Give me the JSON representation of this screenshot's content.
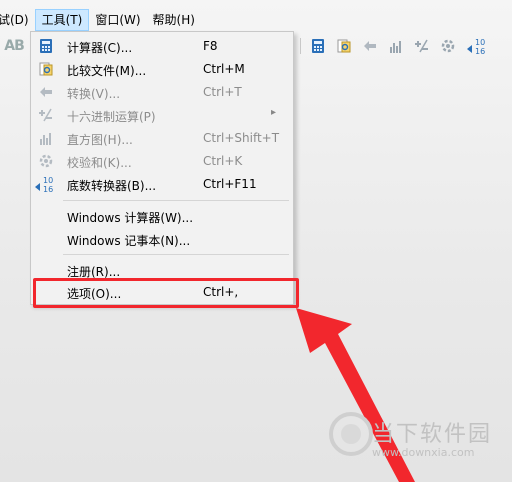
{
  "menubar": {
    "items": [
      "试(D)",
      "工具(T)",
      "窗口(W)",
      "帮助(H)"
    ]
  },
  "toolbar": {
    "left_label": "AB",
    "icons": [
      "calculator-icon",
      "compare-files-icon",
      "convert-icon",
      "histogram-icon",
      "hex-calc-icon",
      "checksum-icon",
      "base-converter-icon"
    ]
  },
  "tools_menu": {
    "items": [
      {
        "label": "计算器(C)...",
        "shortcut": "F8",
        "enabled": true,
        "icon": "calculator-icon"
      },
      {
        "label": "比较文件(M)...",
        "shortcut": "Ctrl+M",
        "enabled": true,
        "icon": "compare-files-icon"
      },
      {
        "label": "转换(V)...",
        "shortcut": "Ctrl+T",
        "enabled": false,
        "icon": "convert-icon"
      },
      {
        "label": "十六进制运算(P)",
        "shortcut": "",
        "enabled": false,
        "icon": "hex-calc-icon",
        "submenu": true
      },
      {
        "label": "直方图(H)...",
        "shortcut": "Ctrl+Shift+T",
        "enabled": false,
        "icon": "histogram-icon"
      },
      {
        "label": "校验和(K)...",
        "shortcut": "Ctrl+K",
        "enabled": false,
        "icon": "checksum-icon"
      },
      {
        "label": "底数转换器(B)...",
        "shortcut": "Ctrl+F11",
        "enabled": true,
        "icon": "base-converter-icon"
      },
      {
        "label": "Windows 计算器(W)...",
        "shortcut": "",
        "enabled": true
      },
      {
        "label": "Windows 记事本(N)...",
        "shortcut": "",
        "enabled": true
      },
      {
        "label": "注册(R)...",
        "shortcut": "",
        "enabled": true
      },
      {
        "label": "选项(O)...",
        "shortcut": "Ctrl+,",
        "enabled": true
      }
    ],
    "base_icon_numbers": [
      "10",
      "16"
    ]
  },
  "watermark": {
    "name": "当下软件园",
    "url": "www.downxia.com"
  },
  "colors": {
    "highlight": "#f2272d",
    "menu_active_bg": "#cde8ff",
    "menu_bg": "#f2f2f2",
    "icon_blue": "#2a6fb8"
  }
}
